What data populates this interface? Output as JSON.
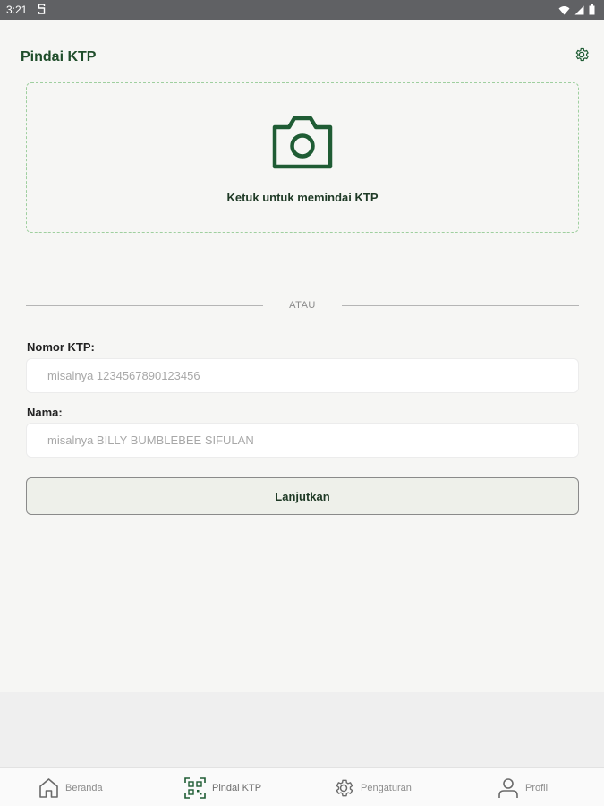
{
  "status_bar": {
    "time": "3:21"
  },
  "header": {
    "title": "Pindai KTP"
  },
  "scan": {
    "label": "Ketuk untuk memindai KTP"
  },
  "divider": {
    "text": "ATAU"
  },
  "form": {
    "ktp_label": "Nomor KTP:",
    "ktp_placeholder": "misalnya 1234567890123456",
    "name_label": "Nama:",
    "name_placeholder": "misalnya BILLY BUMBLEBEE SIFULAN",
    "continue_label": "Lanjutkan"
  },
  "bottom_nav": {
    "items": [
      {
        "label": "Beranda",
        "icon": "home-icon"
      },
      {
        "label": "Pindai KTP",
        "icon": "qr-scan-icon",
        "active": true
      },
      {
        "label": "Pengaturan",
        "icon": "gear-icon"
      },
      {
        "label": "Profil",
        "icon": "person-icon"
      }
    ]
  },
  "colors": {
    "accent": "#1f5c34",
    "title": "#1f4d2a",
    "dashed_border": "#9fcf9f",
    "status_bar": "#606164"
  }
}
